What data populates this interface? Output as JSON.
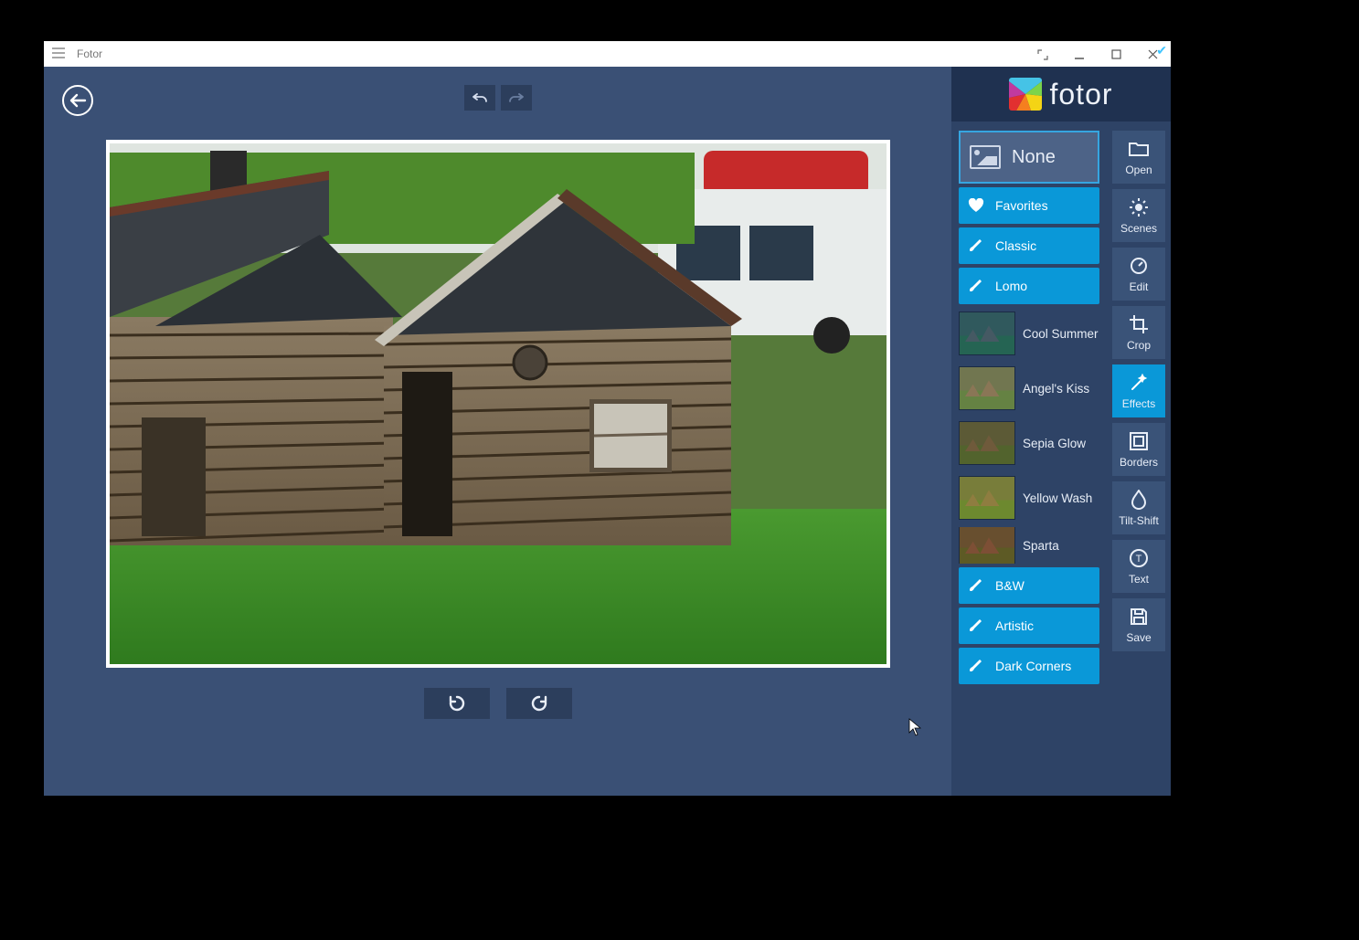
{
  "window": {
    "title": "Fotor"
  },
  "logo": {
    "text": "fotor"
  },
  "effects": {
    "none_label": "None",
    "categories": {
      "favorites": "Favorites",
      "classic": "Classic",
      "lomo": "Lomo",
      "bw": "B&W",
      "artistic": "Artistic",
      "dark_corners": "Dark Corners"
    },
    "presets": {
      "cool_summer": "Cool Summer",
      "angels_kiss": "Angel's Kiss",
      "sepia_glow": "Sepia Glow",
      "yellow_wash": "Yellow Wash",
      "sparta": "Sparta"
    }
  },
  "tools": {
    "open": "Open",
    "scenes": "Scenes",
    "edit": "Edit",
    "crop": "Crop",
    "effects": "Effects",
    "borders": "Borders",
    "tilt_shift": "Tilt-Shift",
    "text": "Text",
    "save": "Save"
  }
}
